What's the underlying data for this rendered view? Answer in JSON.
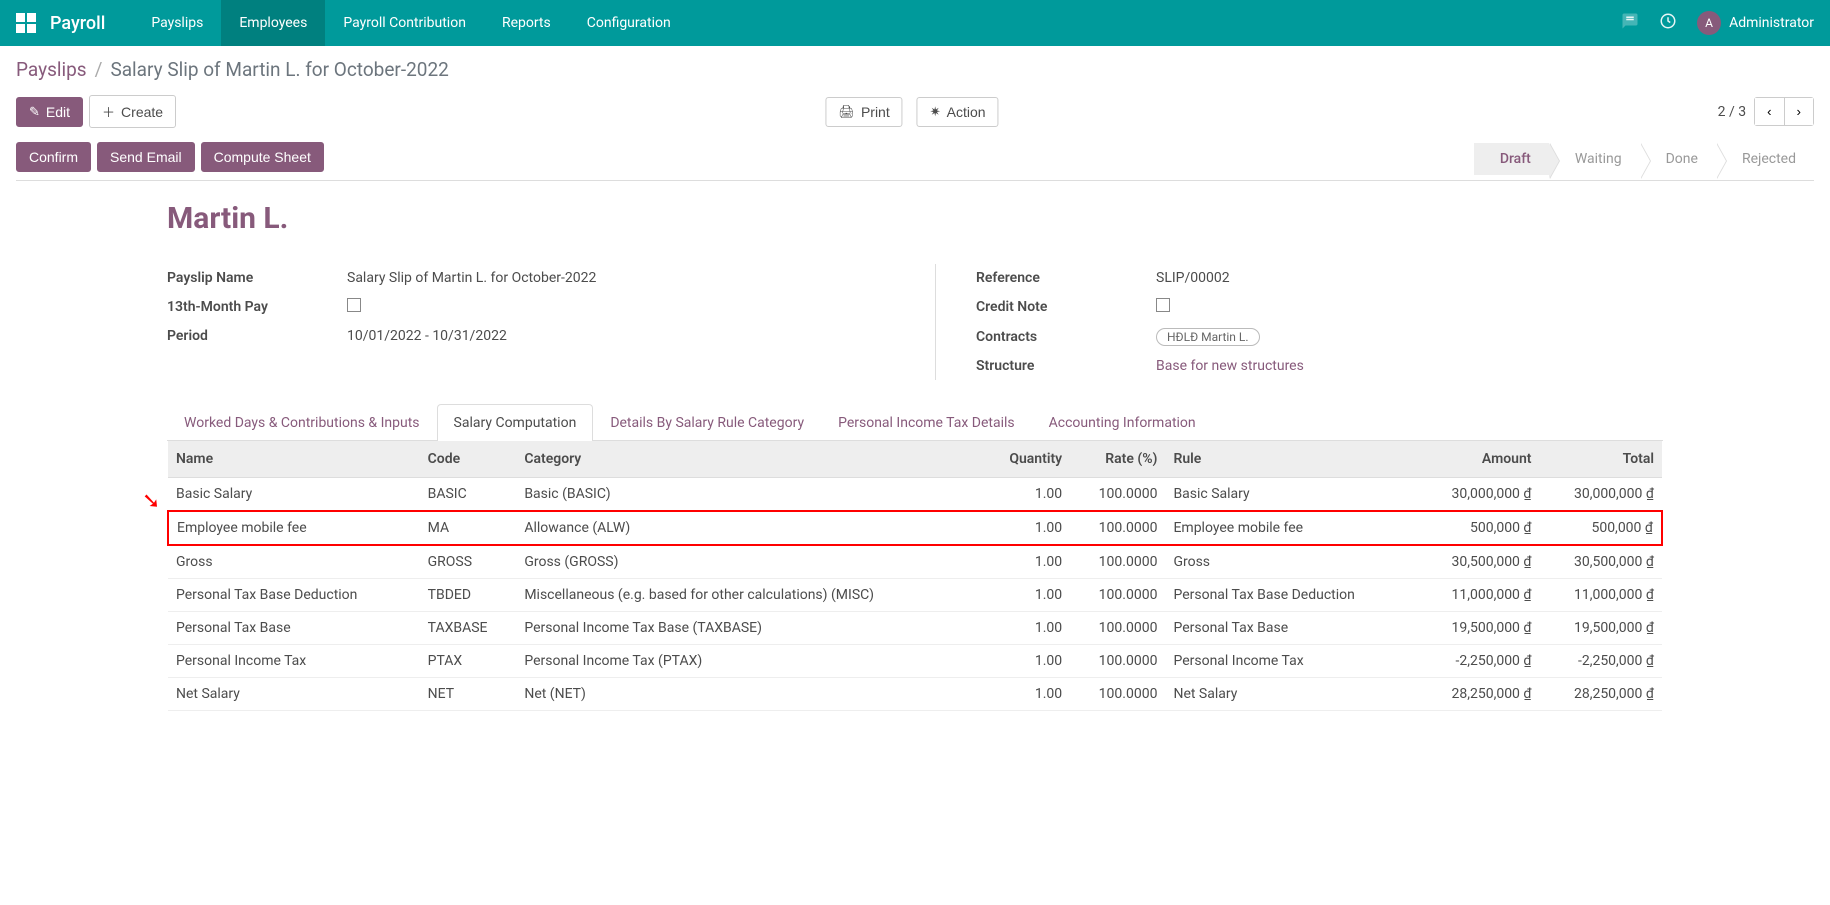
{
  "nav": {
    "app": "Payroll",
    "items": [
      "Payslips",
      "Employees",
      "Payroll Contribution",
      "Reports",
      "Configuration"
    ],
    "active_index": 1,
    "user_initial": "A",
    "user": "Administrator"
  },
  "breadcrumb": {
    "parent": "Payslips",
    "current": "Salary Slip of Martin L. for October-2022"
  },
  "toolbar": {
    "edit": "Edit",
    "create": "Create",
    "print": "Print",
    "action": "Action",
    "pager": "2 / 3"
  },
  "status": {
    "actions": [
      "Confirm",
      "Send Email",
      "Compute Sheet"
    ],
    "steps": [
      "Draft",
      "Waiting",
      "Done",
      "Rejected"
    ],
    "active_step": 0
  },
  "form": {
    "title": "Martin L.",
    "left": {
      "payslip_name_label": "Payslip Name",
      "payslip_name": "Salary Slip of Martin L. for October-2022",
      "month13_label": "13th-Month Pay",
      "period_label": "Period",
      "period": "10/01/2022 - 10/31/2022"
    },
    "right": {
      "reference_label": "Reference",
      "reference": "SLIP/00002",
      "credit_note_label": "Credit Note",
      "contracts_label": "Contracts",
      "contract_tag": "HĐLĐ Martin L.",
      "structure_label": "Structure",
      "structure": "Base for new structures"
    }
  },
  "tabs": {
    "items": [
      "Worked Days & Contributions & Inputs",
      "Salary Computation",
      "Details By Salary Rule Category",
      "Personal Income Tax Details",
      "Accounting Information"
    ],
    "active_index": 1
  },
  "table": {
    "headers": {
      "name": "Name",
      "code": "Code",
      "category": "Category",
      "qty": "Quantity",
      "rate": "Rate (%)",
      "rule": "Rule",
      "amount": "Amount",
      "total": "Total"
    },
    "currency": "₫",
    "highlight_row": 1,
    "rows": [
      {
        "name": "Basic Salary",
        "code": "BASIC",
        "category": "Basic (BASIC)",
        "qty": "1.00",
        "rate": "100.0000",
        "rule": "Basic Salary",
        "amount": "30,000,000",
        "total": "30,000,000"
      },
      {
        "name": "Employee mobile fee",
        "code": "MA",
        "category": "Allowance (ALW)",
        "qty": "1.00",
        "rate": "100.0000",
        "rule": "Employee mobile fee",
        "amount": "500,000",
        "total": "500,000"
      },
      {
        "name": "Gross",
        "code": "GROSS",
        "category": "Gross (GROSS)",
        "qty": "1.00",
        "rate": "100.0000",
        "rule": "Gross",
        "amount": "30,500,000",
        "total": "30,500,000"
      },
      {
        "name": "Personal Tax Base Deduction",
        "code": "TBDED",
        "category": "Miscellaneous (e.g. based for other calculations) (MISC)",
        "qty": "1.00",
        "rate": "100.0000",
        "rule": "Personal Tax Base Deduction",
        "amount": "11,000,000",
        "total": "11,000,000"
      },
      {
        "name": "Personal Tax Base",
        "code": "TAXBASE",
        "category": "Personal Income Tax Base (TAXBASE)",
        "qty": "1.00",
        "rate": "100.0000",
        "rule": "Personal Tax Base",
        "amount": "19,500,000",
        "total": "19,500,000"
      },
      {
        "name": "Personal Income Tax",
        "code": "PTAX",
        "category": "Personal Income Tax (PTAX)",
        "qty": "1.00",
        "rate": "100.0000",
        "rule": "Personal Income Tax",
        "amount": "-2,250,000",
        "total": "-2,250,000"
      },
      {
        "name": "Net Salary",
        "code": "NET",
        "category": "Net (NET)",
        "qty": "1.00",
        "rate": "100.0000",
        "rule": "Net Salary",
        "amount": "28,250,000",
        "total": "28,250,000"
      }
    ]
  }
}
